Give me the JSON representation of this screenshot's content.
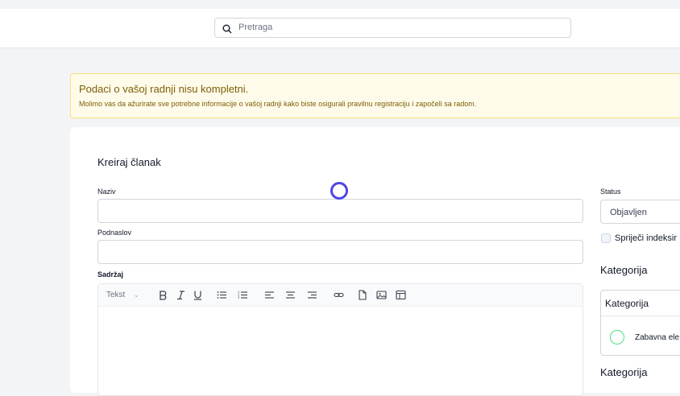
{
  "search": {
    "placeholder": "Pretraga"
  },
  "alert": {
    "title": "Podaci o vašoj radnji nisu kompletni.",
    "description": "Molimo vas da ažurirate sve potrebne informacije o vašoj radnji kako biste osigurali pravilnu registraciju i započeli sa radom."
  },
  "form": {
    "title": "Kreiraj članak",
    "name_label": "Naziv",
    "subtitle_label": "Podnaslov",
    "content_label": "Sadržaj",
    "editor": {
      "text_style": "Tekst",
      "tools": [
        "bold-icon",
        "italic-icon",
        "underline-icon",
        "bullet-list-icon",
        "numbered-list-icon",
        "align-left-icon",
        "align-center-icon",
        "align-right-icon",
        "link-icon",
        "file-icon",
        "image-icon",
        "table-icon"
      ]
    }
  },
  "sidebar": {
    "status_label": "Status",
    "status_value": "Objavljen",
    "noindex_label": "Spriječi indeksir",
    "category_heading": "Kategorija",
    "category_panel_title": "Kategorija",
    "category_item": "Zabavna ele",
    "category_heading_2": "Kategorija"
  },
  "colors": {
    "accent": "#4f46e5",
    "alert_bg": "#fffbea",
    "alert_text": "#7c5e06",
    "radio": "#4ade80"
  }
}
